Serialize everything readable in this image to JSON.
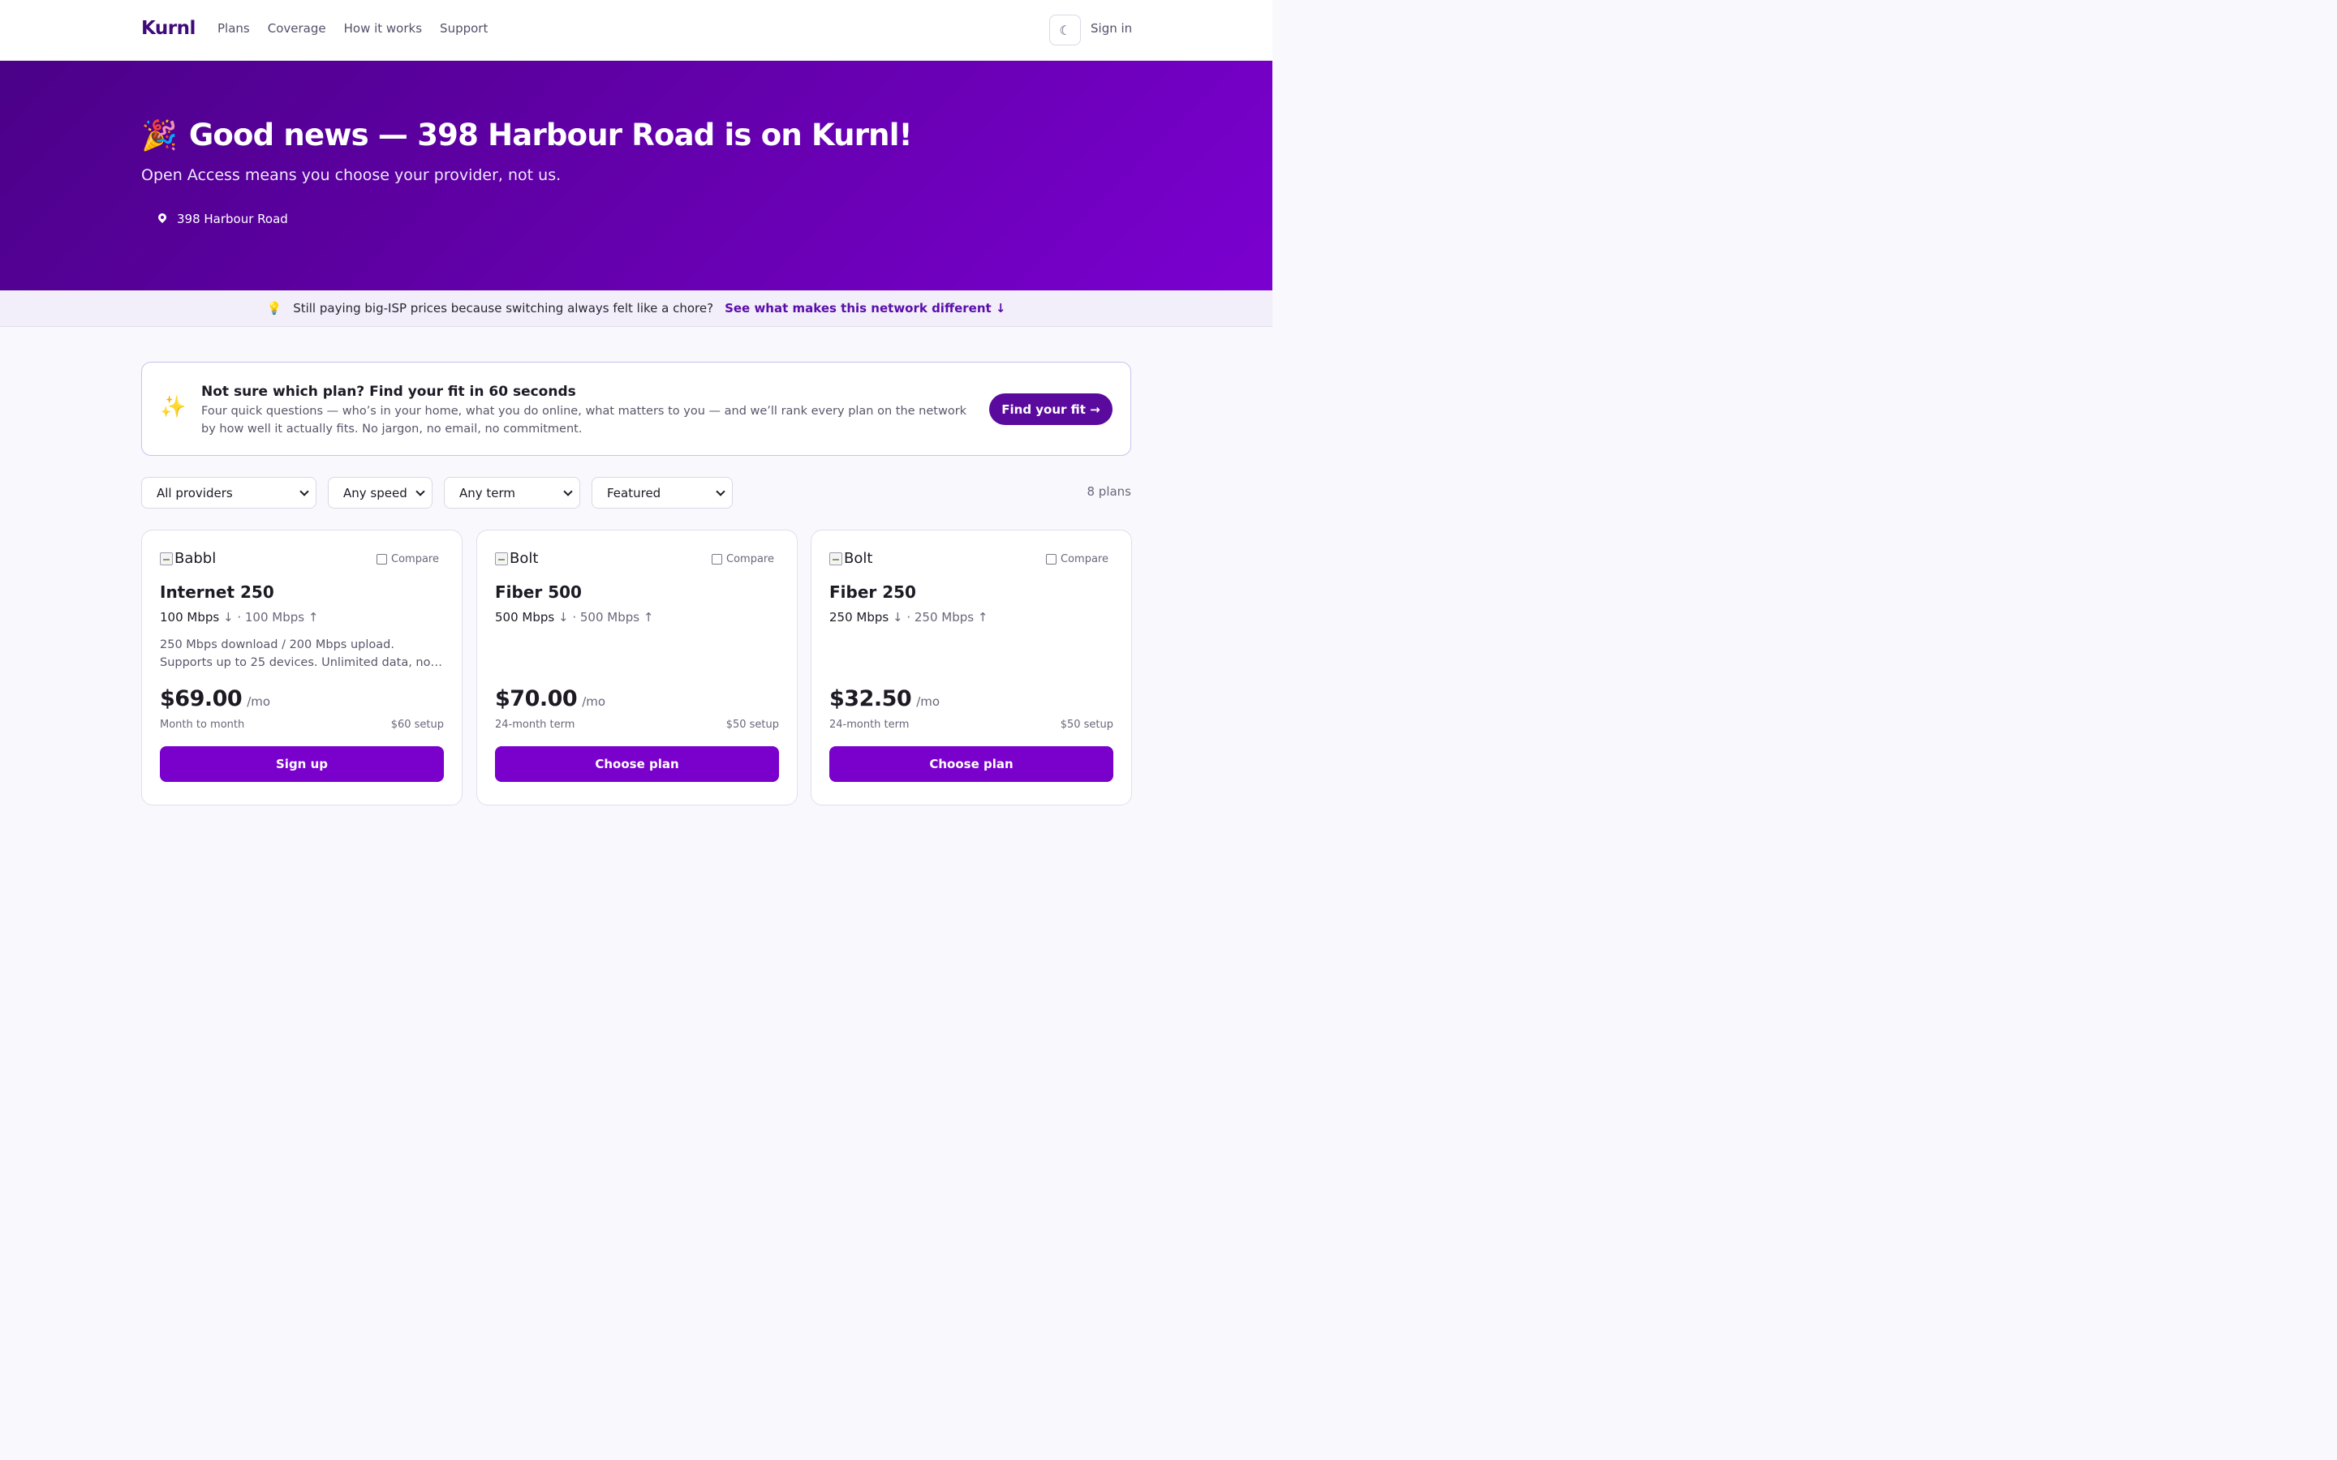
{
  "header": {
    "logo": "Kurnl",
    "nav": [
      "Plans",
      "Coverage",
      "How it works",
      "Support"
    ],
    "theme_icon": "☾",
    "sign_in": "Sign in"
  },
  "hero": {
    "emoji": "🎉",
    "title": "Good news — 398 Harbour Road is on Kurnl!",
    "subtitle": "Open Access means you choose your provider, not us.",
    "address": "398 Harbour Road"
  },
  "banner": {
    "emoji": "💡",
    "text": "Still paying big-ISP prices because switching always felt like a chore?",
    "link": "See what makes this network different ↓"
  },
  "quiz": {
    "emoji": "✨",
    "title": "Not sure which plan? Find your fit in 60 seconds",
    "body": "Four quick questions — who’s in your home, what you do online, what matters to you — and we’ll rank every plan on the network by how well it actually fits. No jargon, no email, no commitment.",
    "button": "Find your fit →"
  },
  "filters": {
    "provider": "All providers",
    "speed": "Any speed",
    "term": "Any term",
    "sort": "Featured",
    "count": "8 plans"
  },
  "plans": [
    {
      "provider": "Babbl",
      "compare": "Compare",
      "name": "Internet 250",
      "down": "100 Mbps",
      "up": "· 100 Mbps ↑",
      "description": "250 Mbps download / 200 Mbps upload. Supports up to 25 devices. Unlimited data, no…",
      "price": "$69.00",
      "per": "/mo",
      "term": "Month to month",
      "setup": "$60 setup",
      "cta": "Sign up"
    },
    {
      "provider": "Bolt",
      "compare": "Compare",
      "name": "Fiber 500",
      "down": "500 Mbps",
      "up": "· 500 Mbps ↑",
      "description": "",
      "price": "$70.00",
      "per": "/mo",
      "term": "24-month term",
      "setup": "$50 setup",
      "cta": "Choose plan"
    },
    {
      "provider": "Bolt",
      "compare": "Compare",
      "name": "Fiber 250",
      "down": "250 Mbps",
      "up": "· 250 Mbps ↑",
      "description": "",
      "price": "$32.50",
      "per": "/mo",
      "term": "24-month term",
      "setup": "$50 setup",
      "cta": "Choose plan"
    }
  ],
  "down_arrow": "↓",
  "colors": {
    "brand": "#3f0a7a",
    "hero_start": "#4b0188",
    "hero_end": "#7b00d0",
    "cta": "#7a00cc",
    "quiz_button": "#5a0a9c"
  }
}
